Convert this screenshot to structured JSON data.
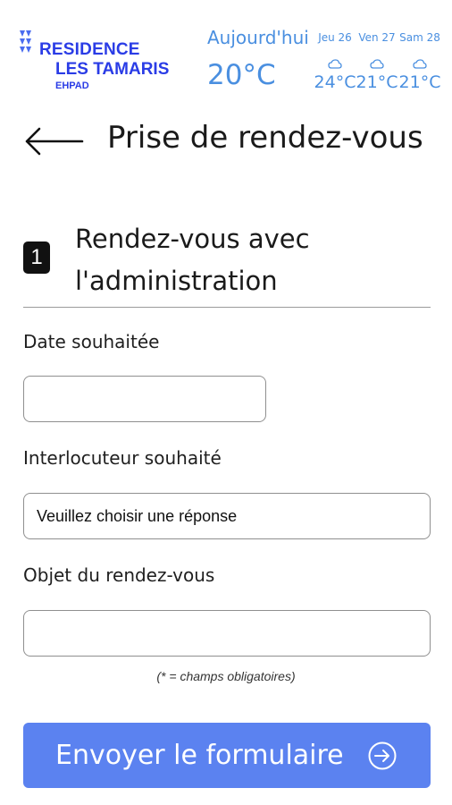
{
  "header": {
    "logo": {
      "line1": "RESIDENCE",
      "line2": "LES TAMARIS",
      "line3": "EHPAD",
      "color": "#2a3ce6"
    },
    "weather": {
      "today_label": "Aujourd'hui",
      "today_temp": "20°C",
      "color": "#4a8fe0",
      "forecast": [
        {
          "day": "Jeu 26",
          "temp": "24°C",
          "icon": "cloud-icon"
        },
        {
          "day": "Ven 27",
          "temp": "21°C",
          "icon": "cloud-icon"
        },
        {
          "day": "Sam 28",
          "temp": "21°C",
          "icon": "cloud-icon"
        }
      ]
    }
  },
  "page": {
    "title": "Prise de rendez-vous",
    "back_icon": "arrow-left-icon"
  },
  "section": {
    "step_number": "1",
    "title": "Rendez-vous avec l'administration"
  },
  "form": {
    "date": {
      "label": "Date souhaitée",
      "value": ""
    },
    "interlocutor": {
      "label": "Interlocuteur souhaité",
      "selected": "Veuillez choisir une réponse"
    },
    "subject": {
      "label": "Objet du rendez-vous",
      "value": ""
    },
    "required_note": "(* = champs obligatoires)",
    "submit": {
      "label": "Envoyer le formulaire",
      "icon": "arrow-circle-right-icon",
      "color": "#5b82f0"
    }
  }
}
